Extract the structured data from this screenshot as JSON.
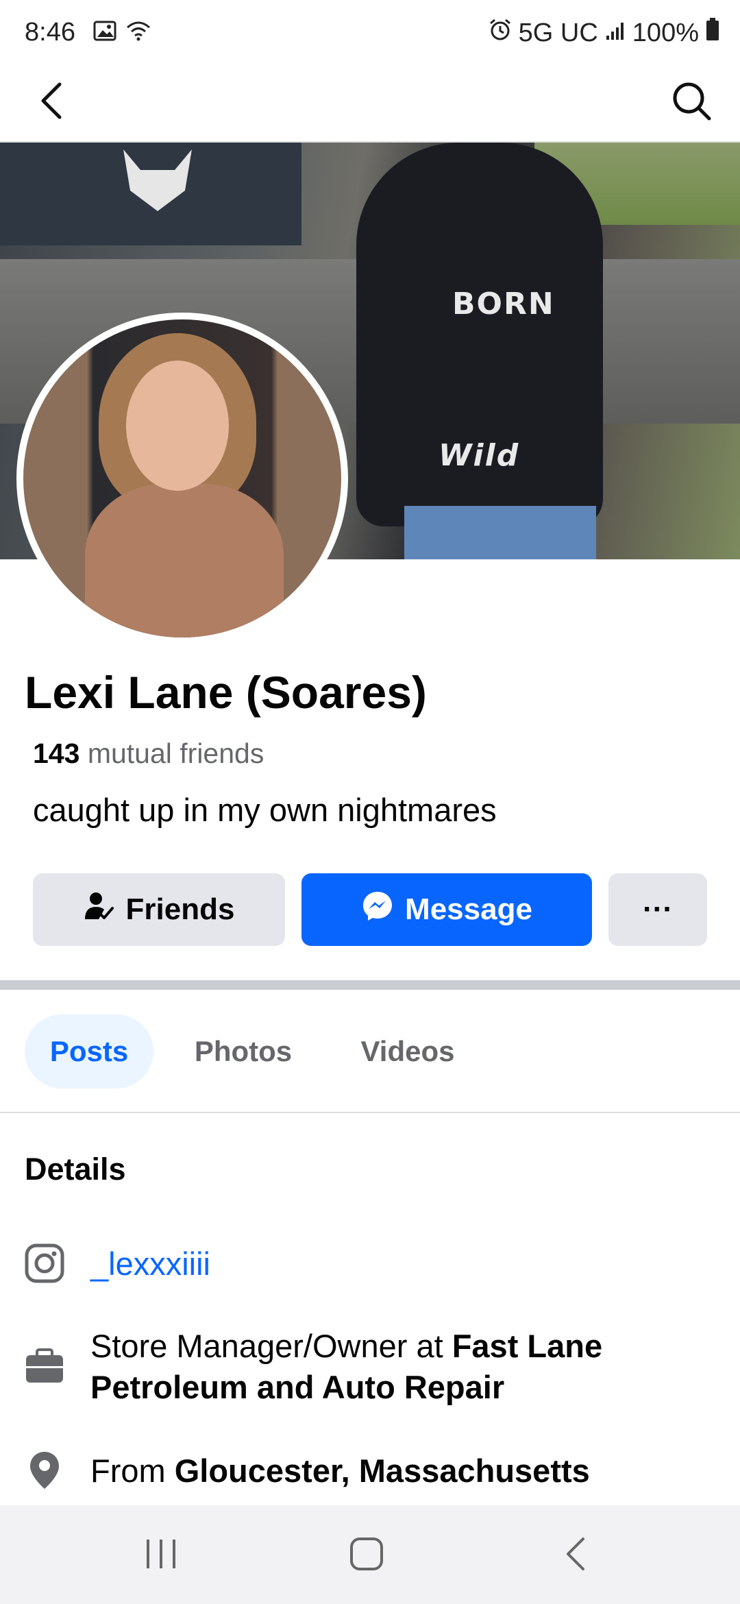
{
  "status_bar": {
    "time": "8:46",
    "network": "5G UC",
    "battery": "100%",
    "icons": [
      "image-icon",
      "wifi-icon",
      "alarm-icon",
      "signal-icon",
      "battery-icon"
    ]
  },
  "top_bar": {
    "back_icon": "chevron-left-icon",
    "search_icon": "search-icon"
  },
  "cover": {
    "hoodie_text_line1": "BORN",
    "hoodie_text_line2": "Wild"
  },
  "profile": {
    "name": "Lexi Lane (Soares)",
    "mutual_count": "143",
    "mutual_label": "mutual friends",
    "bio": "caught up in my own nightmares"
  },
  "actions": {
    "friends_label": "Friends",
    "message_label": "Message",
    "more_label": "···"
  },
  "tabs": [
    {
      "label": "Posts",
      "active": true
    },
    {
      "label": "Photos",
      "active": false
    },
    {
      "label": "Videos",
      "active": false
    }
  ],
  "details": {
    "title": "Details",
    "instagram": "_lexxxiiii",
    "work_prefix": "Store Manager/Owner at ",
    "work_place": "Fast Lane Petroleum and Auto Repair",
    "from_prefix": "From ",
    "from_place": "Gloucester, Massachusetts"
  },
  "colors": {
    "accent": "#0866ff",
    "button_gray": "#e4e6eb",
    "muted_text": "#65676b",
    "active_tab_bg": "#ebf5ff"
  }
}
